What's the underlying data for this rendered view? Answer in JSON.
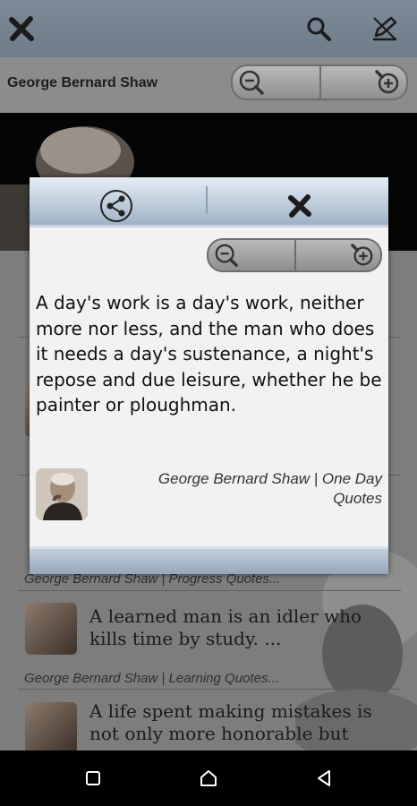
{
  "app": {
    "title": "George Bernard Shaw"
  },
  "toolbar": {
    "close_icon": "close-icon",
    "search_icon": "search-icon",
    "edit_icon": "edit-icon"
  },
  "list": {
    "items": [
      {
        "meta": "George Bernard Shaw | Progress Quotes..."
      },
      {
        "quote": "A learned man is an idler who kills time by study. ...",
        "meta": "George Bernard Shaw | Learning Quotes..."
      },
      {
        "quote": "A life spent making mistakes is not only more honorable but"
      }
    ]
  },
  "dialog": {
    "quote": "A day's work is a day's work, neither more nor less, and the man who does it needs a day's sustenance, a night's repose and due leisure, whether he be painter or ploughman.",
    "attribution": "George Bernard Shaw | One Day Quotes"
  },
  "colors": {
    "toolbar": "#7d8a98",
    "dialog_header": "#9fb2c6",
    "overlay": "#9a9a9a"
  }
}
